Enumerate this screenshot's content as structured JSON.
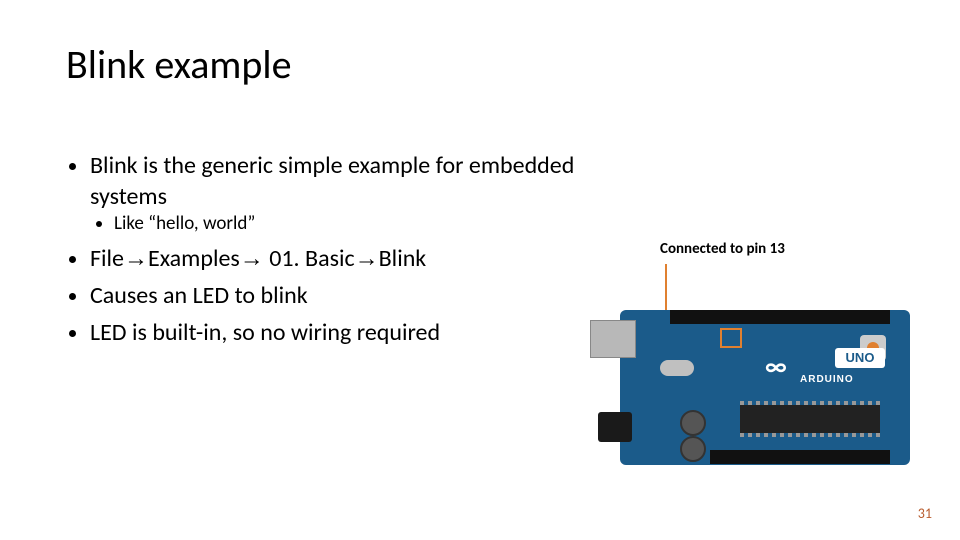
{
  "title": "Blink example",
  "bullets": {
    "b1": "Blink is the generic simple example for embedded systems",
    "b1a": "Like “hello, world”",
    "b2_pre": "File",
    "b2_a": "Examples",
    "b2_b": " 01. Basic",
    "b2_c": "Blink",
    "b3": "Causes an LED to blink",
    "b4": "LED is built-in, so no wiring required"
  },
  "callout": "Connected to pin 13",
  "board": {
    "brand": "ARDUINO",
    "model": "UNO",
    "symbol": "∞"
  },
  "page": "31"
}
